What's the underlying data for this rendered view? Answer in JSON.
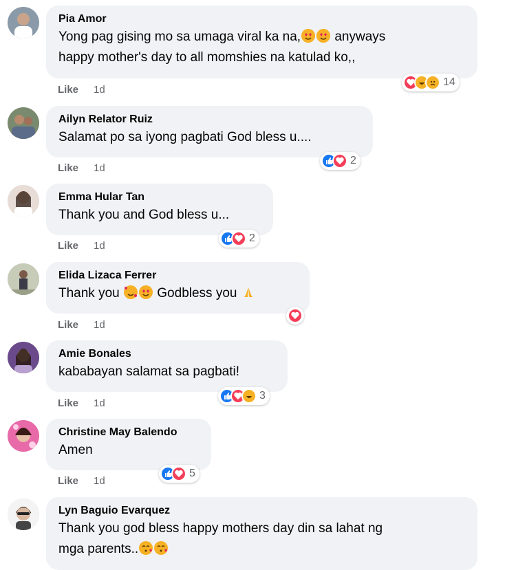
{
  "comments": [
    {
      "name": "Pia Amor",
      "line1": "Yong pag gising mo sa umaga viral ka na,",
      "line1b": " anyways",
      "line2": "happy mother's day to all momshies na katulad ko,,",
      "like": "Like",
      "time": "1d",
      "count": "14"
    },
    {
      "name": "Ailyn Relator Ruiz",
      "line1": "Salamat po sa iyong pagbati God bless u....",
      "like": "Like",
      "time": "1d",
      "count": "2"
    },
    {
      "name": "Emma Hular Tan",
      "line1": "Thank you and God bless u...",
      "like": "Like",
      "time": "1d",
      "count": "2"
    },
    {
      "name": "Elida Lizaca Ferrer",
      "line1a": "Thank you ",
      "line1b": " Godbless you ",
      "like": "Like",
      "time": "1d"
    },
    {
      "name": "Amie Bonales",
      "line1": "kababayan salamat sa pagbati!",
      "like": "Like",
      "time": "1d",
      "count": "3"
    },
    {
      "name": "Christine May Balendo",
      "line1": "Amen",
      "like": "Like",
      "time": "1d",
      "count": "5"
    },
    {
      "name": "Lyn Baguio Evarquez",
      "line1": "Thank you god bless happy mothers day din sa lahat ng",
      "line2": "mga parents.."
    }
  ],
  "colors": {
    "bubble": "#f0f2f5",
    "like": "#1877f2",
    "love": "#f33e58",
    "emoji": "#f7b125",
    "meta": "#65676b"
  }
}
